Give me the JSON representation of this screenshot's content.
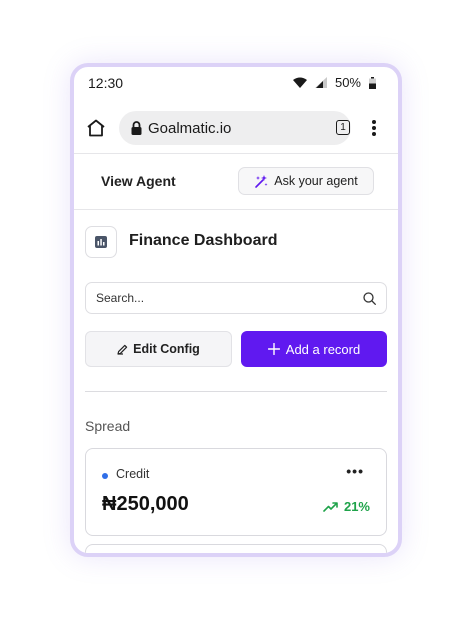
{
  "status_bar": {
    "time": "12:30",
    "battery": "50%"
  },
  "browser": {
    "url": "Goalmatic.io",
    "tab_count": "1"
  },
  "header": {
    "view_agent": "View Agent",
    "ask_agent": "Ask your agent"
  },
  "dashboard": {
    "title": "Finance Dashboard"
  },
  "search": {
    "placeholder": "Search..."
  },
  "actions": {
    "edit_config": "Edit Config",
    "add_record": "Add a record"
  },
  "section": {
    "label": "Spread"
  },
  "card": {
    "label": "Credit",
    "amount": "₦250,000",
    "change": "21%",
    "dot_color": "#2f6ee8",
    "change_color": "#1fa34a"
  },
  "colors": {
    "accent": "#6019f0",
    "frame": "#dcd2f7"
  }
}
